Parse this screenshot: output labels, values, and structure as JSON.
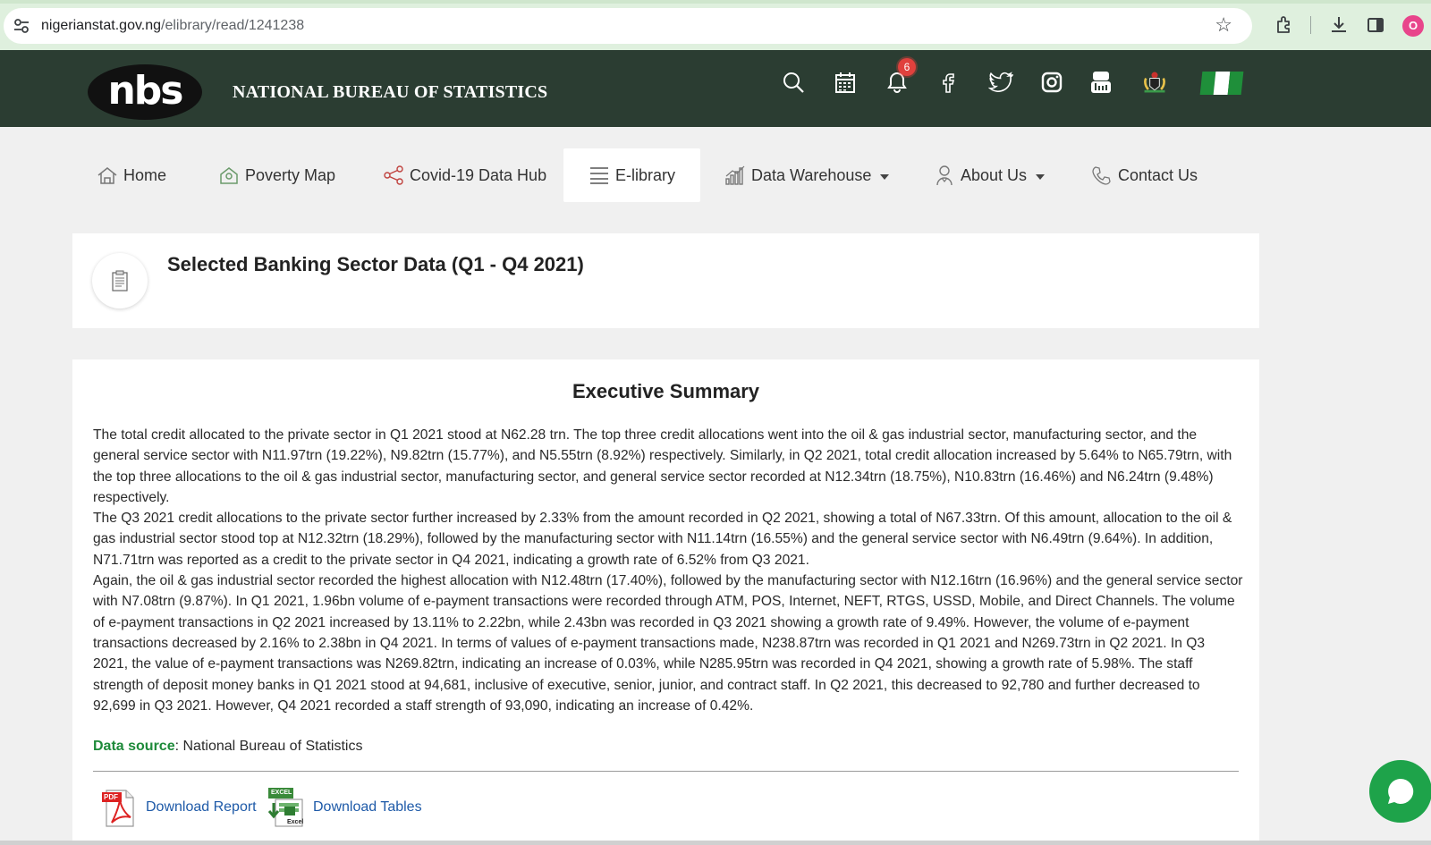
{
  "browser": {
    "url_host": "nigerianstat.gov.ng",
    "url_path": "/elibrary/read/1241238",
    "profile_initial": "O",
    "icons": [
      "tune-icon",
      "star-icon",
      "extensions-icon",
      "download-icon",
      "sidepanel-icon",
      "profile-avatar"
    ]
  },
  "header": {
    "logo_text": "nbs",
    "title": "NATIONAL BUREAU OF STATISTICS",
    "notification_count": "6",
    "icons": [
      "search-icon",
      "calendar-icon",
      "bell-icon",
      "facebook-icon",
      "twitter-icon",
      "instagram-icon",
      "youtube-icon",
      "coat-of-arms-icon",
      "nigeria-flag-icon"
    ],
    "colors": {
      "background": "#2b3d32",
      "badge": "#e0413d",
      "flag_green": "#1f8f3a"
    }
  },
  "nav": {
    "items": [
      {
        "label": "Home",
        "icon": "home-icon"
      },
      {
        "label": "Poverty Map",
        "icon": "map-icon"
      },
      {
        "label": "Covid-19 Data Hub",
        "icon": "share-icon"
      },
      {
        "label": "E-library",
        "icon": "menu-lines-icon",
        "active": true
      },
      {
        "label": "Data Warehouse",
        "icon": "bar-chart-icon",
        "dropdown": true
      },
      {
        "label": "About Us",
        "icon": "person-icon",
        "dropdown": true
      },
      {
        "label": "Contact Us",
        "icon": "phone-icon"
      }
    ]
  },
  "document": {
    "title": "Selected Banking Sector Data (Q1 - Q4 2021)",
    "icon": "clipboard-icon"
  },
  "summary": {
    "heading": "Executive Summary",
    "paragraphs": [
      "The total credit allocated to the private sector in Q1 2021 stood at N62.28 trn. The top three credit allocations went into the oil & gas industrial sector, manufacturing sector, and the general service sector with N11.97trn (19.22%), N9.82trn (15.77%), and N5.55trn (8.92%) respectively. Similarly, in Q2 2021, total credit allocation increased by 5.64% to N65.79trn, with the top three allocations to the oil & gas industrial sector, manufacturing sector, and general service sector recorded at N12.34trn (18.75%), N10.83trn (16.46%) and N6.24trn (9.48%) respectively.",
      "The Q3 2021 credit allocations to the private sector further increased by 2.33% from the amount recorded in Q2 2021, showing a total of N67.33trn. Of this amount, allocation to the oil & gas industrial sector stood top at N12.32trn (18.29%), followed by the manufacturing sector with N11.14trn (16.55%) and the general service sector with N6.49trn (9.64%). In addition, N71.71trn was reported as a credit to the private sector in Q4 2021, indicating a growth rate of 6.52% from Q3 2021.",
      "Again, the oil & gas industrial sector recorded the highest allocation with N12.48trn (17.40%), followed by the manufacturing sector with N12.16trn (16.96%) and the general service sector with N7.08trn (9.87%). In Q1 2021, 1.96bn volume of e-payment transactions were recorded through ATM, POS, Internet, NEFT, RTGS, USSD, Mobile, and Direct Channels. The volume of e-payment transactions in Q2 2021 increased by 13.11% to 2.22bn, while 2.43bn was recorded in Q3 2021 showing a growth rate of 9.49%. However, the volume of e-payment transactions decreased by 2.16% to 2.38bn in Q4 2021. In terms of values of e-payment transactions made, N238.87trn was recorded in Q1 2021 and N269.73trn in Q2 2021. In Q3 2021, the value of e-payment transactions was N269.82trn, indicating an increase of 0.03%, while N285.95trn was recorded in Q4 2021, showing a growth rate of 5.98%. The staff strength of deposit money banks in Q1 2021 stood at 94,681, inclusive of executive, senior, junior, and contract staff. In Q2 2021, this decreased to 92,780 and further decreased to 92,699 in Q3 2021. However, Q4 2021 recorded a staff strength of 93,090, indicating an increase of 0.42%."
    ],
    "data_source_label": "Data source",
    "data_source_value": ": National Bureau of Statistics",
    "download_report": "Download Report",
    "download_tables": "Download Tables",
    "pdf_badge": "PDF",
    "excel_badge": "EXCEL",
    "excel_sub": "Excel"
  }
}
